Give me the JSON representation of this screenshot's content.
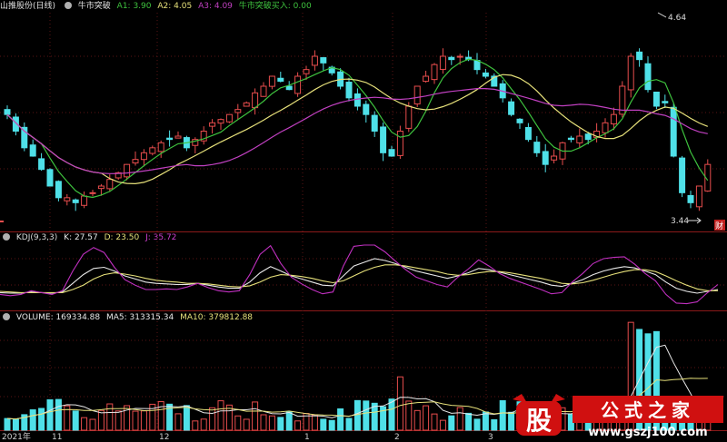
{
  "header": {
    "stock_title": "山推股份(日线)",
    "indicator_name": "牛市突破",
    "a1_label": "A1: 3.90",
    "a2_label": "A2: 4.05",
    "a3_label": "A3: 4.09",
    "signal_label": "牛市突破买入: 0.00"
  },
  "price_chart": {
    "high_label": "4.64",
    "low_label": "3.44",
    "finance_badge": "财"
  },
  "kdj": {
    "name": "KDJ(9,3,3)",
    "k_label": "K: 27.57",
    "d_label": "D: 23.50",
    "j_label": "J: 35.72"
  },
  "volume": {
    "name": "VOLUME: 169334.88",
    "ma5_label": "MA5: 313315.34",
    "ma10_label": "MA10: 379812.88"
  },
  "x_axis": {
    "year_label": "2021年",
    "ticks": [
      "11",
      "12",
      "1",
      "2",
      "3"
    ]
  },
  "watermark": {
    "badge": "股",
    "site_name": "公式之家",
    "url": "www.gszj100.com"
  },
  "colors": {
    "up": "#e84d4d",
    "down": "#4fe0e8",
    "ma_green": "#3ec23e",
    "ma_yellow": "#e6e07a",
    "ma_magenta": "#c040c0",
    "border_red": "#8b1a1a"
  },
  "chart_data": {
    "type": "candlestick",
    "price_range": [
      3.44,
      4.64
    ],
    "price_closes": [
      4.05,
      3.95,
      3.85,
      3.8,
      3.72,
      3.62,
      3.55,
      3.55,
      3.52,
      3.56,
      3.58,
      3.62,
      3.66,
      3.7,
      3.75,
      3.78,
      3.82,
      3.85,
      3.88,
      3.9,
      3.92,
      3.85,
      3.9,
      3.95,
      4.0,
      4.02,
      4.05,
      4.08,
      4.12,
      4.18,
      4.22,
      4.28,
      4.25,
      4.2,
      4.28,
      4.32,
      4.4,
      4.36,
      4.3,
      4.22,
      4.15,
      4.1,
      4.05,
      3.95,
      3.82,
      3.8,
      3.95,
      4.1,
      4.22,
      4.28,
      4.35,
      4.4,
      4.38,
      4.4,
      4.38,
      4.32,
      4.28,
      4.22,
      4.15,
      4.05,
      4.0,
      3.9,
      3.82,
      3.75,
      3.8,
      3.88,
      3.9,
      3.92,
      3.9,
      3.95,
      4.0,
      4.05,
      4.22,
      4.4,
      4.38,
      4.2,
      4.1,
      4.12,
      3.8,
      3.58,
      3.52,
      3.62,
      3.75
    ],
    "kdj_k": [
      23,
      22,
      22,
      24,
      23,
      22,
      24,
      38,
      52,
      62,
      64,
      58,
      50,
      45,
      40,
      38,
      37,
      36,
      36,
      38,
      35,
      32,
      30,
      30,
      40,
      55,
      65,
      58,
      50,
      45,
      40,
      35,
      34,
      50,
      66,
      72,
      78,
      75,
      70,
      64,
      58,
      54,
      50,
      46,
      50,
      55,
      62,
      60,
      56,
      52,
      48,
      44,
      40,
      35,
      33,
      38,
      44,
      52,
      58,
      62,
      65,
      63,
      58,
      52,
      40,
      30,
      25,
      22,
      25,
      28
    ],
    "kdj_d": [
      25,
      24,
      23,
      23,
      23,
      23,
      23,
      28,
      35,
      45,
      52,
      55,
      53,
      50,
      46,
      43,
      41,
      40,
      38,
      38,
      37,
      35,
      33,
      32,
      34,
      40,
      48,
      52,
      51,
      49,
      46,
      42,
      39,
      42,
      50,
      58,
      64,
      68,
      68,
      66,
      63,
      60,
      57,
      53,
      51,
      52,
      55,
      57,
      57,
      55,
      52,
      49,
      46,
      42,
      38,
      37,
      39,
      43,
      48,
      53,
      57,
      60,
      60,
      57,
      50,
      42,
      35,
      29,
      26,
      26
    ],
    "kdj_j": [
      20,
      18,
      20,
      26,
      23,
      20,
      26,
      58,
      85,
      96,
      88,
      64,
      44,
      35,
      28,
      28,
      29,
      28,
      32,
      38,
      31,
      26,
      24,
      26,
      52,
      85,
      99,
      70,
      48,
      37,
      28,
      21,
      24,
      66,
      98,
      100,
      100,
      89,
      74,
      60,
      48,
      42,
      36,
      32,
      48,
      61,
      76,
      66,
      54,
      46,
      40,
      34,
      28,
      21,
      23,
      40,
      54,
      70,
      78,
      80,
      81,
      69,
      54,
      42,
      20,
      6,
      5,
      8,
      23,
      36
    ],
    "volume_max": 380000
  }
}
